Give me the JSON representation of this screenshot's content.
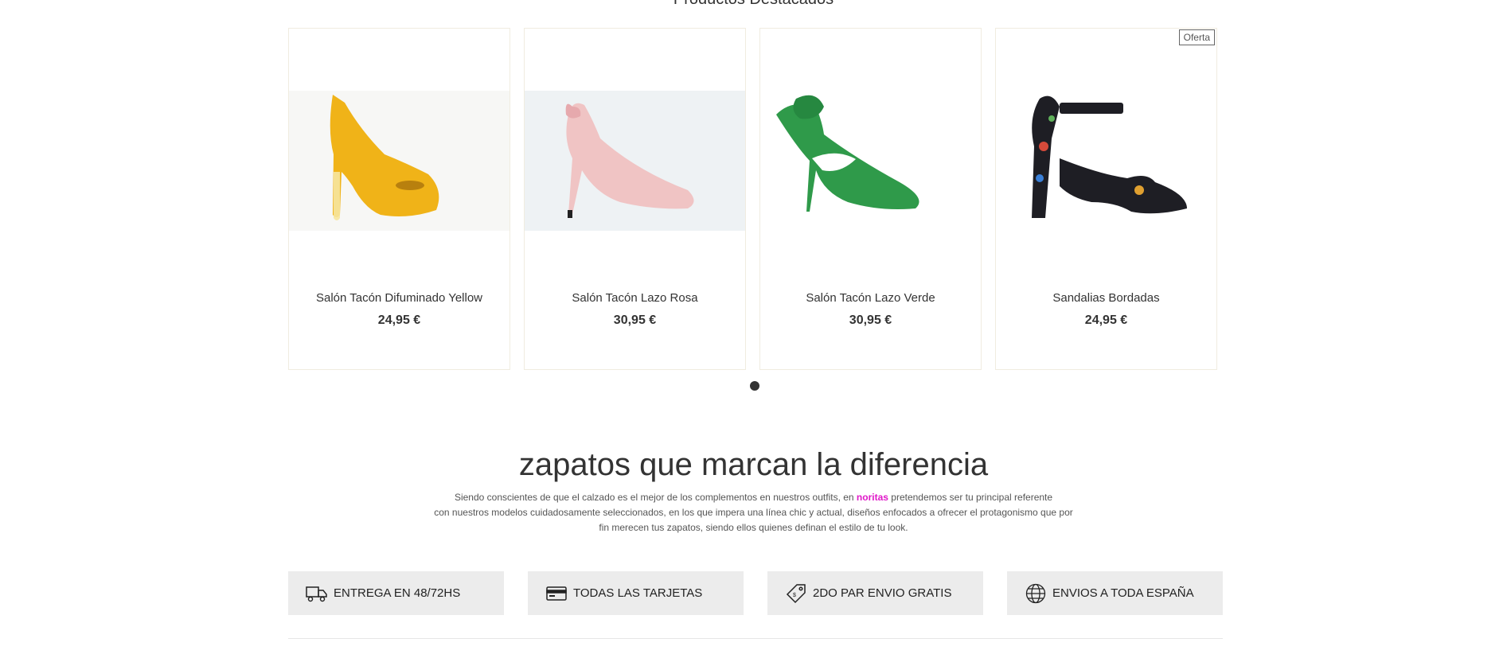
{
  "section": {
    "title": "Productos Destacados"
  },
  "products": [
    {
      "name": "Salón Tacón Difuminado Yellow",
      "price": "24,95 €",
      "color": "#f0b318"
    },
    {
      "name": "Salón Tacón Lazo Rosa",
      "price": "30,95 €",
      "color": "#f0c4c4"
    },
    {
      "name": "Salón Tacón Lazo Verde",
      "price": "30,95 €",
      "color": "#2f9a4a"
    },
    {
      "name": "Sandalias Bordadas",
      "price": "24,95 €",
      "badge": "Oferta",
      "color": "#1e1e24"
    }
  ],
  "about": {
    "headline": "zapatos que marcan la diferencia",
    "line1_before": "Siendo conscientes de que el calzado es el mejor de los complementos en nuestros outfits, en ",
    "brand": "noritas",
    "line1_after": " pretendemos ser tu principal referente",
    "line2": "con nuestros modelos cuidadosamente seleccionados, en los que impera una línea chic y actual, diseños enfocados a ofrecer el protagonismo que por",
    "line3": "fin merecen tus zapatos, siendo ellos quienes definan el estilo de tu look."
  },
  "features": [
    {
      "icon": "truck-icon",
      "label": "ENTREGA EN 48/72HS"
    },
    {
      "icon": "credit-card-icon",
      "label": "TODAS LAS TARJETAS"
    },
    {
      "icon": "tag-icon",
      "label": "2DO PAR ENVIO GRATIS"
    },
    {
      "icon": "globe-icon",
      "label": "ENVIOS A TODA ESPAÑA"
    }
  ],
  "colors": {
    "brand": "#e018c8",
    "feature_bg": "#ececec"
  }
}
